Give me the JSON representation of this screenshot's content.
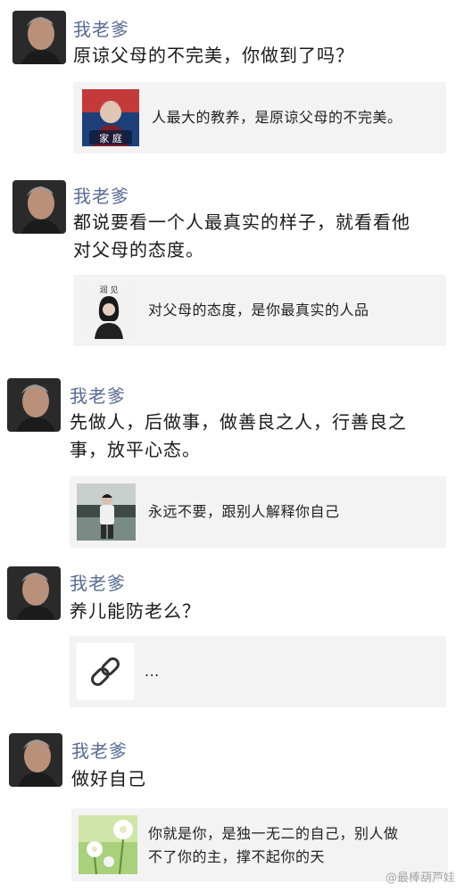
{
  "posts": [
    {
      "author": "我老爹",
      "text_lines": [
        "原谅父母的不完美，你做到了吗？"
      ],
      "card": {
        "title_lines": [
          "人最大的教养，是原谅父母的不完美。"
        ],
        "thumb_icon": "portrait-thumbnail",
        "thumb_caption": "家 庭"
      }
    },
    {
      "author": "我老爹",
      "text_lines": [
        "都说要看一个人最真实的样子，就看看他",
        "对父母的态度。"
      ],
      "card": {
        "title_lines": [
          "对父母的态度，是你最真实的人品"
        ],
        "thumb_icon": "portrait-thumbnail",
        "thumb_caption": "润 见"
      }
    },
    {
      "author": "我老爹",
      "text_lines": [
        "先做人，后做事，做善良之人，行善良之",
        "事，放平心态。"
      ],
      "card": {
        "title_lines": [
          "永远不要，跟别人解释你自己"
        ],
        "thumb_icon": "person-thumbnail"
      }
    },
    {
      "author": "我老爹",
      "text_lines": [
        "养儿能防老么？"
      ],
      "card": {
        "title_lines": [
          "..."
        ],
        "thumb_icon": "link-icon"
      }
    },
    {
      "author": "我老爹",
      "text_lines": [
        "做好自己"
      ],
      "card": {
        "title_lines": [
          "你就是你，是独一无二的自己，别人做",
          "不了你的主，撑不起你的天"
        ],
        "thumb_icon": "flower-thumbnail"
      }
    }
  ],
  "watermark": "@最棒葫芦娃",
  "colors": {
    "author": "#576b95",
    "card_bg": "#f3f3f3",
    "text": "#1a1a1a"
  }
}
